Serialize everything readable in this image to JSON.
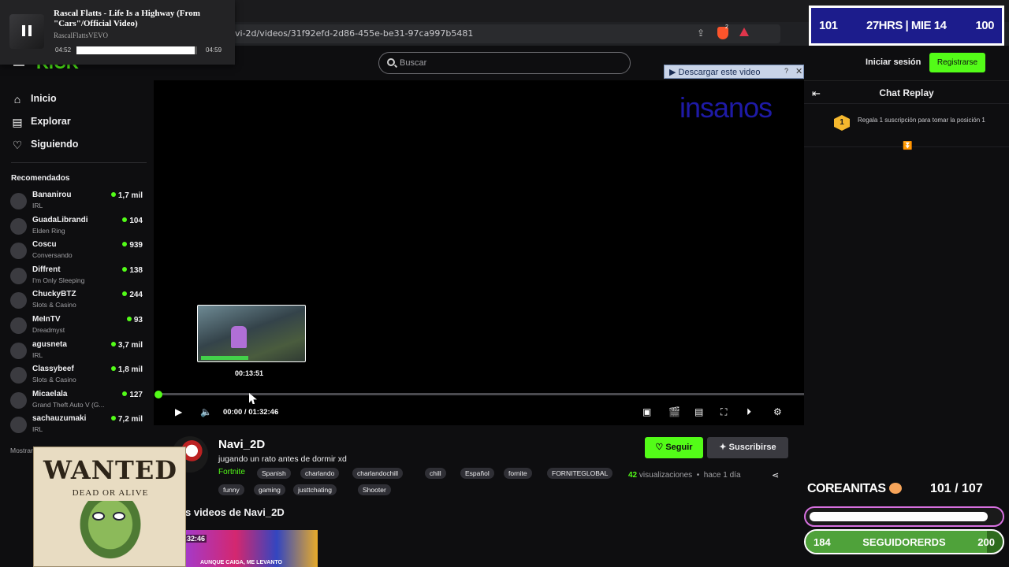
{
  "browser": {
    "url": "vi-2d/videos/31f92efd-2d86-455e-be31-97ca997b5481",
    "brave_badge": "2"
  },
  "media_popup": {
    "title": "Rascal Flatts - Life Is a Highway (From \"Cars\"/Official Video)",
    "channel": "RascalFlattsVEVO",
    "current": "04:52",
    "duration": "04:59",
    "progress": 0.98
  },
  "scoreboard": {
    "left": "101",
    "center": "27HRS | MIE 14",
    "right": "100"
  },
  "header": {
    "logo": "KICK",
    "search_placeholder": "Buscar",
    "download_label": "▶ Descargar este video",
    "download_help": "?",
    "download_close": "✕"
  },
  "auth": {
    "login": "Iniciar sesión",
    "register": "Registrarse"
  },
  "chat": {
    "title": "Chat Replay",
    "gift_badge": "1",
    "gift_text": "Regala 1 suscripción para tomar la posición 1"
  },
  "nav": [
    {
      "icon": "⌂",
      "label": "Inicio"
    },
    {
      "icon": "▤",
      "label": "Explorar"
    },
    {
      "icon": "♡",
      "label": "Siguiendo"
    }
  ],
  "recommended": {
    "title": "Recomendados",
    "show_more": "Mostrar m",
    "items": [
      {
        "name": "Bananirou",
        "category": "IRL",
        "viewers": "1,7 mil"
      },
      {
        "name": "GuadaLibrandi",
        "category": "Elden Ring",
        "viewers": "104"
      },
      {
        "name": "Coscu",
        "category": "Conversando",
        "viewers": "939"
      },
      {
        "name": "Diffrent",
        "category": "I'm Only Sleeping",
        "viewers": "138"
      },
      {
        "name": "ChuckyBTZ",
        "category": "Slots & Casino",
        "viewers": "244"
      },
      {
        "name": "MeInTV",
        "category": "Dreadmyst",
        "viewers": "93"
      },
      {
        "name": "agusneta",
        "category": "IRL",
        "viewers": "3,7 mil"
      },
      {
        "name": "Classybeef",
        "category": "Slots & Casino",
        "viewers": "1,8 mil"
      },
      {
        "name": "Micaelala",
        "category": "Grand Theft Auto V (G...",
        "viewers": "127"
      },
      {
        "name": "sachauzumaki",
        "category": "IRL",
        "viewers": "7,2 mil"
      }
    ]
  },
  "player": {
    "overlay_text": "insanos",
    "preview_time": "00:13:51",
    "time_label": "00:00 / 01:32:46",
    "progress": 0
  },
  "video": {
    "channel": "Navi_2D",
    "title": "jugando un rato antes de dormir xd",
    "category": "Fortnite",
    "tags": [
      "Spanish",
      "charlando",
      "charlandochill",
      "chill",
      "Español",
      "fornite",
      "FORNITEGLOBAL",
      "funny",
      "gaming",
      "justtchating",
      "Shooter"
    ],
    "follow": "Seguir",
    "subscribe": "Suscribirse",
    "views_count": "42",
    "views_label": "visualizaciones",
    "age": "hace 1 día",
    "more_title": "s videos de Navi_2D",
    "thumb_duration": ":32:46",
    "thumb_caption": "AUNQUE CAIGA, ME LEVANTO"
  },
  "wanted": {
    "line1": "WANTED",
    "line2": "DEAD OR ALIVE"
  },
  "overlay_goals": {
    "label": "COREANITAS",
    "count": "101  /  107",
    "sub_progress": 0.94,
    "followers_current": "184",
    "followers_label": "SEGUIDORERDS",
    "followers_goal": "200",
    "followers_progress": 0.92
  },
  "colors": {
    "accent": "#53fc18",
    "background": "#0e0e10",
    "scoreboard": "#1c1c8c"
  }
}
